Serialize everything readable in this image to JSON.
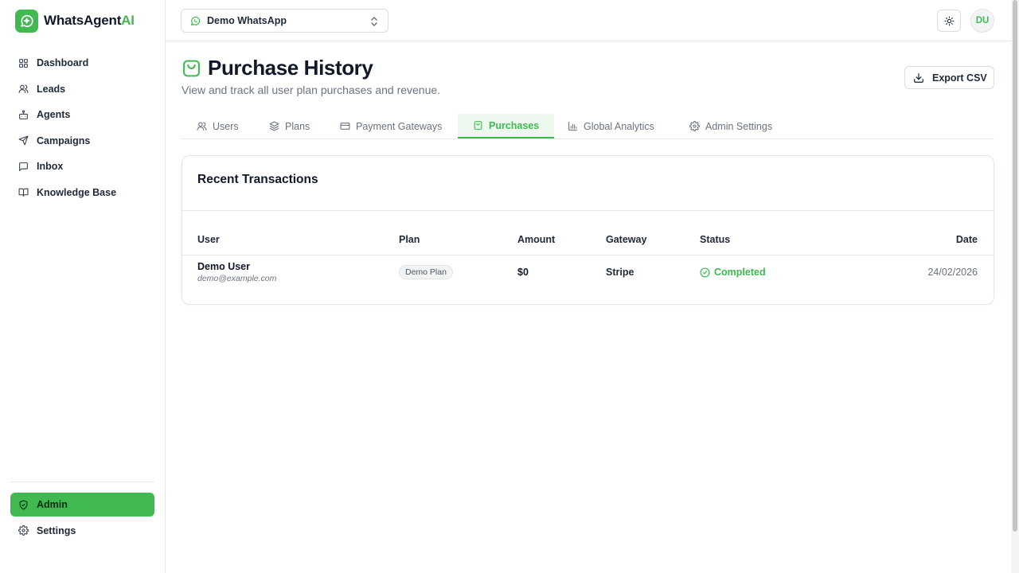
{
  "brand": {
    "name_main": "WhatsAgent",
    "name_accent": "AI"
  },
  "colors": {
    "accent": "#3fb950",
    "text": "#111827",
    "muted": "#6b7280",
    "border": "#e5e7eb"
  },
  "sidebar": {
    "items": [
      {
        "label": "Dashboard",
        "icon": "dashboard-grid-icon"
      },
      {
        "label": "Leads",
        "icon": "users-icon"
      },
      {
        "label": "Agents",
        "icon": "bot-icon"
      },
      {
        "label": "Campaigns",
        "icon": "send-icon"
      },
      {
        "label": "Inbox",
        "icon": "message-square-icon"
      },
      {
        "label": "Knowledge Base",
        "icon": "book-open-icon"
      }
    ],
    "bottom_items": [
      {
        "label": "Admin",
        "icon": "shield-check-icon",
        "active": true
      },
      {
        "label": "Settings",
        "icon": "gear-icon"
      }
    ]
  },
  "topbar": {
    "workspace": "Demo WhatsApp",
    "avatar_initials": "DU"
  },
  "page": {
    "title": "Purchase History",
    "subtitle": "View and track all user plan purchases and revenue.",
    "export_label": "Export CSV"
  },
  "tabs": [
    {
      "label": "Users",
      "icon": "users-icon"
    },
    {
      "label": "Plans",
      "icon": "layers-icon"
    },
    {
      "label": "Payment Gateways",
      "icon": "credit-card-icon"
    },
    {
      "label": "Purchases",
      "icon": "shopping-bag-icon",
      "active": true
    },
    {
      "label": "Global Analytics",
      "icon": "bar-chart-icon"
    },
    {
      "label": "Admin Settings",
      "icon": "gear-icon"
    }
  ],
  "transactions": {
    "title": "Recent Transactions",
    "columns": [
      "User",
      "Plan",
      "Amount",
      "Gateway",
      "Status",
      "Date"
    ],
    "rows": [
      {
        "user_name": "Demo User",
        "user_email": "demo@example.com",
        "plan": "Demo Plan",
        "amount": "$0",
        "gateway": "Stripe",
        "status": "Completed",
        "date": "24/02/2026"
      }
    ]
  }
}
